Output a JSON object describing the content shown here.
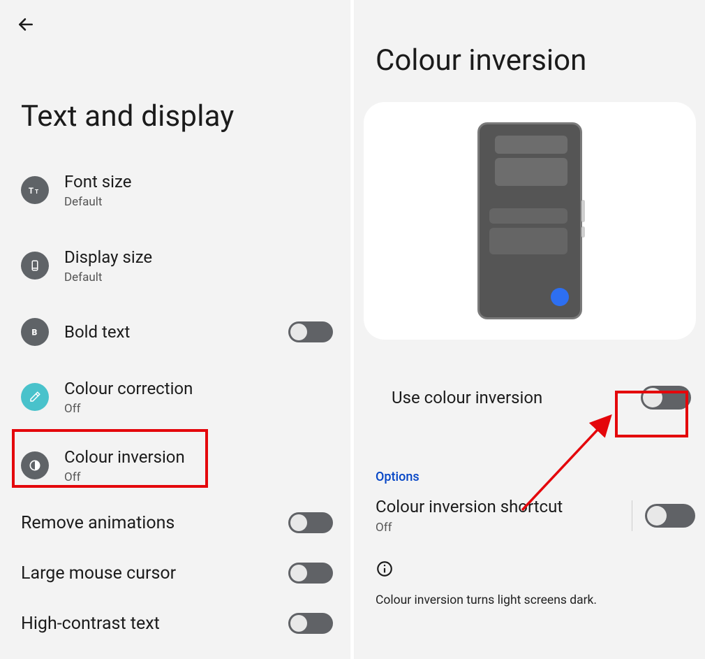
{
  "left": {
    "title": "Text and display",
    "items": {
      "font_size": {
        "title": "Font size",
        "sub": "Default"
      },
      "display_size": {
        "title": "Display size",
        "sub": "Default"
      },
      "bold_text": {
        "title": "Bold text",
        "toggled": false
      },
      "colour_correction": {
        "title": "Colour correction",
        "sub": "Off"
      },
      "colour_inversion": {
        "title": "Colour inversion",
        "sub": "Off"
      },
      "remove_animations": {
        "title": "Remove animations",
        "toggled": false
      },
      "large_cursor": {
        "title": "Large mouse cursor",
        "toggled": false
      },
      "high_contrast": {
        "title": "High-contrast text",
        "toggled": false
      }
    }
  },
  "right": {
    "title": "Colour inversion",
    "use_label": "Use colour inversion",
    "use_toggled": false,
    "options_label": "Options",
    "shortcut_title": "Colour inversion shortcut",
    "shortcut_sub": "Off",
    "shortcut_toggled": false,
    "info_text": "Colour inversion turns light screens dark."
  },
  "annotations": {
    "highlight_colour": "#e4060b"
  }
}
